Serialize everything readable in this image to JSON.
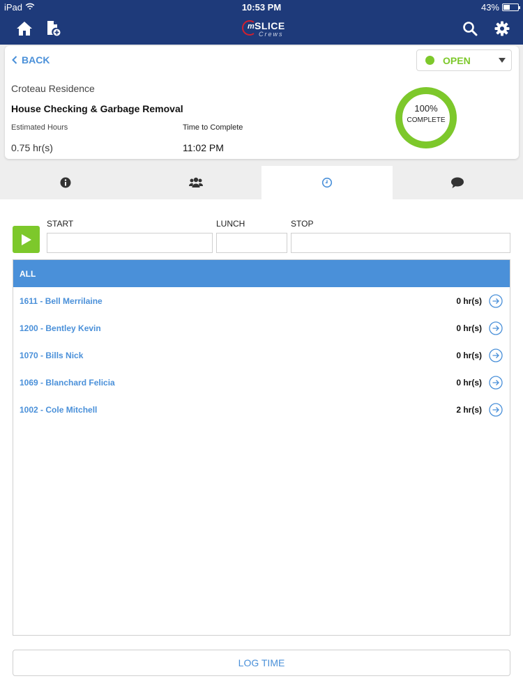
{
  "status_bar": {
    "device": "iPad",
    "time": "10:53 PM",
    "battery": "43%",
    "battery_level": 0.43
  },
  "nav": {
    "home_icon": "home-icon",
    "new_doc_icon": "add-document-icon",
    "search_icon": "search-icon",
    "settings_icon": "gear-icon",
    "logo": {
      "m": "m",
      "name": "SLICE",
      "tagline": "Crews"
    }
  },
  "job": {
    "back_label": "BACK",
    "status": "OPEN",
    "status_color": "#7dc82b",
    "client": "Croteau Residence",
    "title": "House Checking & Garbage Removal",
    "estimated_hours_label": "Estimated Hours",
    "estimated_hours": "0.75 hr(s)",
    "time_to_complete_label": "Time to Complete",
    "time_to_complete": "11:02 PM",
    "progress_fraction": 1.0,
    "progress_percent": "100%",
    "progress_caption": "COMPLETE"
  },
  "tabs": [
    {
      "icon": "info-icon",
      "active": false
    },
    {
      "icon": "users-icon",
      "active": false
    },
    {
      "icon": "clock-icon",
      "active": true
    },
    {
      "icon": "comment-icon",
      "active": false
    }
  ],
  "time_entry": {
    "start_label": "START",
    "start_value": "",
    "lunch_label": "LUNCH",
    "lunch_value": "",
    "stop_label": "STOP",
    "stop_value": ""
  },
  "employees": {
    "header": "ALL",
    "rows": [
      {
        "name": "1611 - Bell Merrilaine",
        "hours": "0 hr(s)"
      },
      {
        "name": "1200 - Bentley Kevin",
        "hours": "0 hr(s)"
      },
      {
        "name": "1070 - Bills Nick",
        "hours": "0 hr(s)"
      },
      {
        "name": "1069 - Blanchard Felicia",
        "hours": "0 hr(s)"
      },
      {
        "name": "1002 - Cole Mitchell",
        "hours": "2 hr(s)"
      }
    ]
  },
  "actions": {
    "log_time_label": "LOG TIME"
  },
  "colors": {
    "header_bg": "#1e3a7a",
    "accent_blue": "#4a90d9",
    "accent_green": "#7dc82b"
  }
}
